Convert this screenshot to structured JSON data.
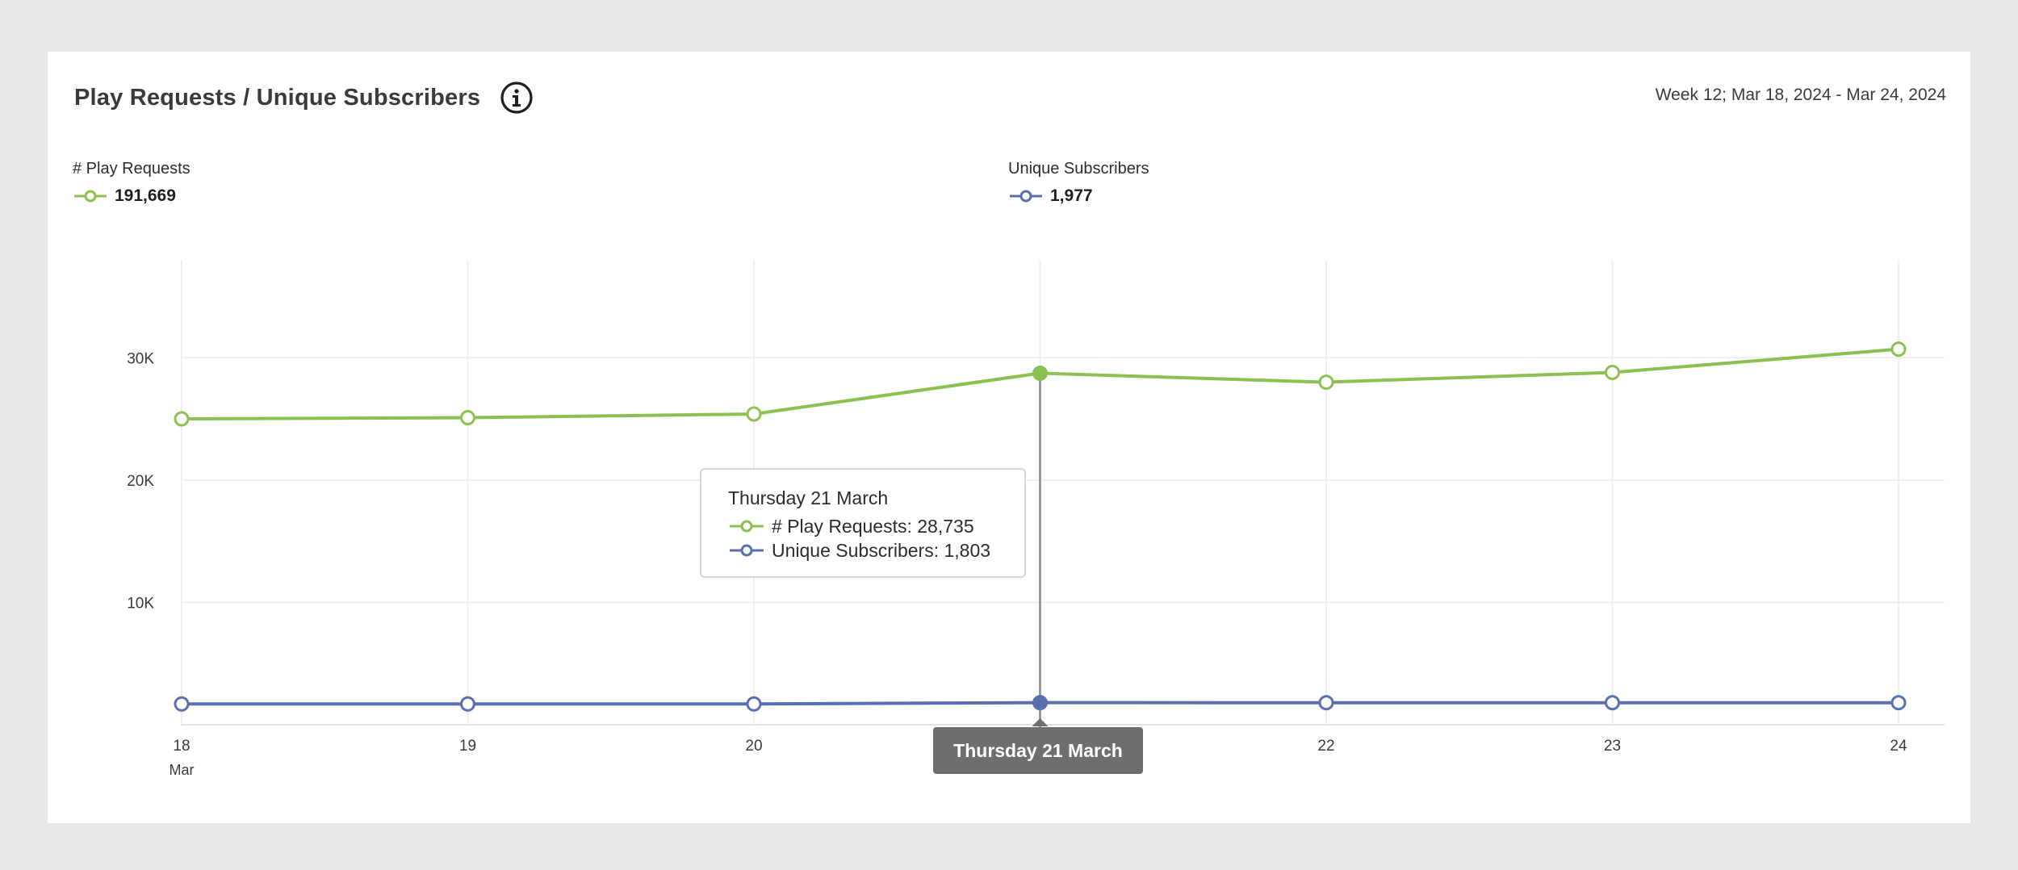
{
  "header": {
    "title": "Play Requests / Unique Subscribers",
    "date_range": "Week 12; Mar 18, 2024 - Mar 24, 2024",
    "info_icon": "info-circle-icon"
  },
  "legend": [
    {
      "label": "# Play Requests",
      "total": "191,669",
      "color": "#8cc152"
    },
    {
      "label": "Unique Subscribers",
      "total": "1,977",
      "color": "#5b6eb0"
    }
  ],
  "tooltip": {
    "title": "Thursday 21 March",
    "rows": [
      {
        "text": "# Play Requests: 28,735"
      },
      {
        "text": "Unique Subscribers: 1,803"
      }
    ]
  },
  "hover_label": "Thursday 21 March",
  "chart_data": {
    "type": "line",
    "x": [
      "18",
      "19",
      "20",
      "21",
      "22",
      "23",
      "24"
    ],
    "x_sublabel": "Mar",
    "ylim": [
      0,
      38000
    ],
    "y_ticks": [
      {
        "value": 10000,
        "label": "10K"
      },
      {
        "value": 20000,
        "label": "20K"
      },
      {
        "value": 30000,
        "label": "30K"
      }
    ],
    "grid": true,
    "highlight_index": 3,
    "series": [
      {
        "name": "# Play Requests",
        "color": "#8cc152",
        "values": [
          25000,
          25100,
          25400,
          28735,
          28000,
          28800,
          30700
        ]
      },
      {
        "name": "Unique Subscribers",
        "color": "#5b6eb0",
        "values": [
          1700,
          1700,
          1700,
          1803,
          1800,
          1800,
          1800
        ]
      }
    ]
  }
}
